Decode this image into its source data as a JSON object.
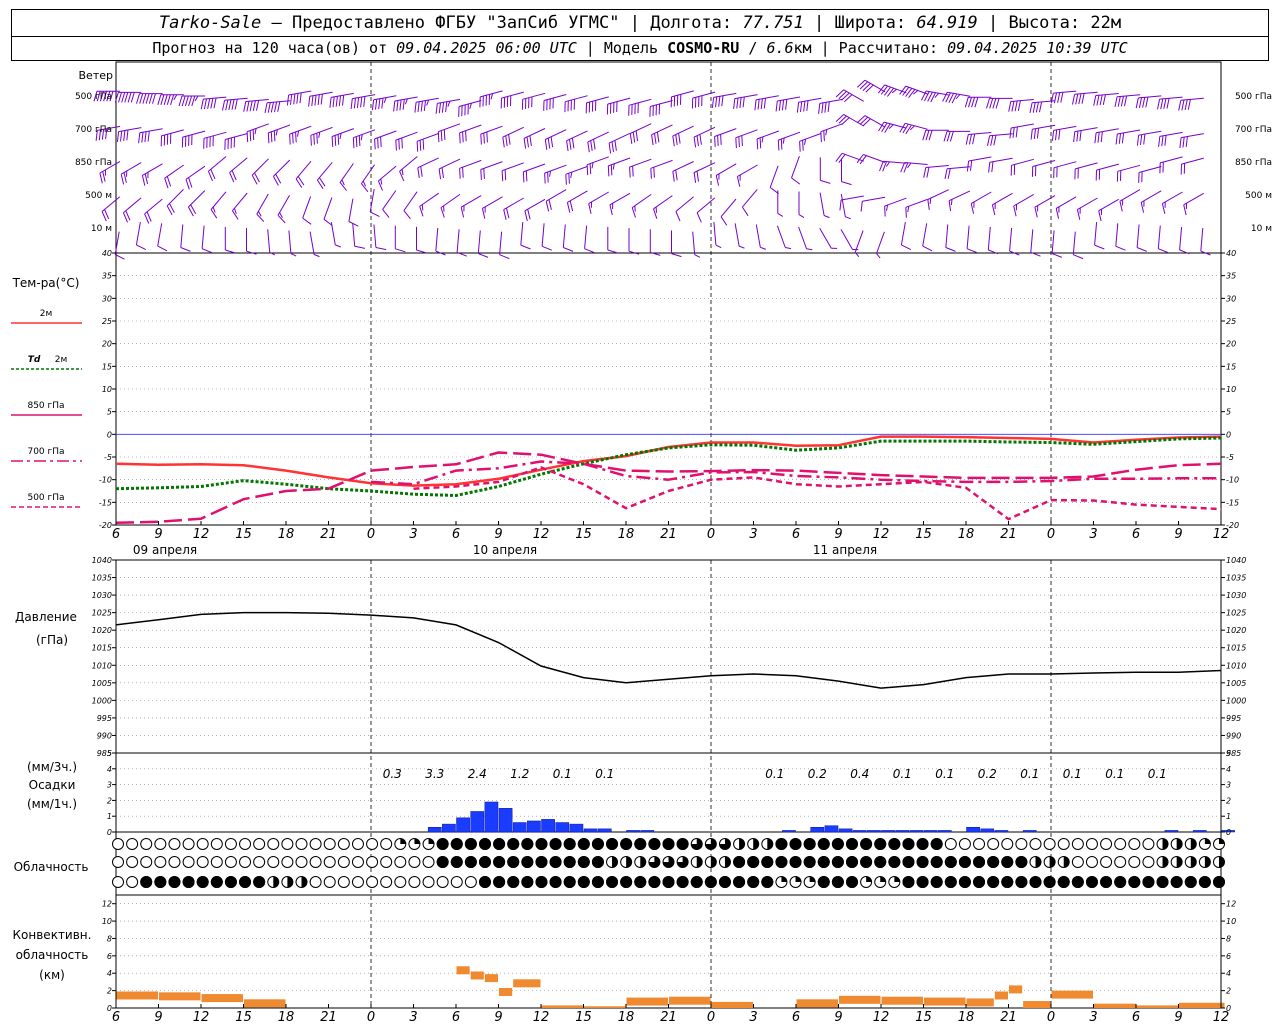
{
  "header": {
    "station": "Tarko-Sale",
    "provider": " – Предоставлено ФГБУ \"ЗапСиб УГМС\" | ",
    "lon_label": "Долгота: ",
    "lon": "77.751",
    "lat_label": " | Широта: ",
    "lat": "64.919",
    "alt_label": " | Высота: ",
    "alt": "22м",
    "forecast_label": "Прогноз на 120 часа(ов) от ",
    "forecast_from": "09.04.2025 06:00 UTC",
    "model_label": "  | Модель ",
    "model": "COSMO-RU",
    "model_sep": " / ",
    "resolution": "6.6",
    "resolution_unit": "км",
    "calc_label": " | Рассчитано: ",
    "calc_time": "09.04.2025 10:39 UTC"
  },
  "labels": {
    "wind": "Ветер",
    "wind_levels": [
      "500 гПа",
      "700 гПа",
      "850 гПа",
      "500 м",
      "10 м"
    ],
    "temp_title": "Тем-ра(°С)",
    "t2m": "2м",
    "td_prefix": "Td",
    "td2m": "2м",
    "t850": "850 гПа",
    "t700": "700 гПа",
    "t500": "500 гПа",
    "pressure1": "Давление",
    "pressure2": "(гПа)",
    "precip1": "(мм/3ч.)",
    "precip2": "Осадки",
    "precip3": "(мм/1ч.)",
    "cloud": "Облачность",
    "conv1": "Конвективн.",
    "conv2": "облачность",
    "conv3": "(км)"
  },
  "colors": {
    "t2m": "#ff3333",
    "td": "#007700",
    "upper": "#e0106e",
    "wind": "#7700cc",
    "precip": "#1a3cff",
    "conv": "#f08a30",
    "zero_line": "#3333ff"
  },
  "chart_data": [
    {
      "type": "wind-barbs",
      "levels": [
        "500 гПа",
        "700 гПа",
        "850 гПа",
        "500 м",
        "10 м"
      ],
      "x_hours": [
        0,
        3,
        6,
        9,
        12,
        15,
        18,
        21,
        24,
        27,
        30,
        33,
        36,
        39,
        42,
        45,
        48,
        51,
        54,
        57,
        60,
        63,
        66,
        69,
        72,
        75,
        78
      ],
      "speed_ms": [
        [
          30,
          30,
          28,
          27,
          26,
          25,
          25,
          24,
          23,
          23,
          22,
          22,
          21,
          21,
          21,
          20,
          20,
          20,
          22,
          23,
          23,
          22,
          22,
          21,
          21,
          21,
          21
        ],
        [
          22,
          22,
          21,
          20,
          19,
          18,
          18,
          17,
          17,
          17,
          16,
          16,
          16,
          15,
          15,
          15,
          14,
          14,
          17,
          18,
          17,
          16,
          16,
          16,
          16,
          16,
          16
        ],
        [
          13,
          13,
          12,
          11,
          10,
          10,
          9,
          9,
          10,
          11,
          12,
          13,
          13,
          12,
          11,
          9,
          6,
          5,
          12,
          13,
          12,
          11,
          11,
          11,
          11,
          11,
          11
        ],
        [
          11,
          11,
          10,
          9,
          8,
          7,
          6,
          7,
          8,
          9,
          10,
          10,
          9,
          8,
          7,
          5,
          4,
          4,
          7,
          8,
          8,
          9,
          9,
          9,
          9,
          9,
          9
        ],
        [
          6,
          6,
          5,
          5,
          4,
          4,
          5,
          6,
          6,
          6,
          6,
          6,
          5,
          5,
          4,
          3,
          3,
          3,
          4,
          5,
          5,
          6,
          6,
          6,
          6,
          6,
          6
        ]
      ],
      "dir_deg": [
        [
          270,
          270,
          270,
          265,
          265,
          260,
          260,
          260,
          260,
          255,
          255,
          255,
          255,
          255,
          255,
          260,
          260,
          260,
          300,
          290,
          280,
          270,
          265,
          265,
          265,
          265,
          265
        ],
        [
          260,
          260,
          255,
          255,
          250,
          250,
          250,
          250,
          250,
          250,
          245,
          245,
          245,
          245,
          245,
          250,
          250,
          250,
          300,
          285,
          270,
          265,
          260,
          260,
          260,
          260,
          260
        ],
        [
          240,
          240,
          235,
          230,
          225,
          220,
          215,
          230,
          245,
          250,
          250,
          250,
          250,
          250,
          245,
          240,
          200,
          180,
          290,
          275,
          265,
          260,
          255,
          255,
          255,
          255,
          255
        ],
        [
          230,
          230,
          225,
          220,
          210,
          200,
          190,
          215,
          235,
          240,
          240,
          240,
          240,
          235,
          230,
          220,
          180,
          170,
          260,
          250,
          245,
          240,
          240,
          240,
          240,
          240,
          240
        ],
        [
          190,
          190,
          185,
          180,
          175,
          170,
          175,
          180,
          185,
          185,
          185,
          185,
          180,
          180,
          175,
          170,
          160,
          150,
          200,
          190,
          185,
          185,
          185,
          185,
          185,
          185,
          185
        ]
      ]
    },
    {
      "type": "line",
      "title": "Тем-ра(°С)",
      "ylim": [
        -20,
        40
      ],
      "yticks": [
        -20,
        -15,
        -10,
        -5,
        0,
        5,
        10,
        15,
        20,
        25,
        30,
        35,
        40
      ],
      "x_hours": [
        0,
        3,
        6,
        9,
        12,
        15,
        18,
        21,
        24,
        27,
        30,
        33,
        36,
        39,
        42,
        45,
        48,
        51,
        54,
        57,
        60,
        63,
        66,
        69,
        72,
        75,
        78
      ],
      "series": [
        {
          "name": "2м",
          "values": [
            -6.5,
            -6.7,
            -6.6,
            -6.8,
            -8.0,
            -9.5,
            -10.8,
            -11.3,
            -11.0,
            -9.8,
            -7.8,
            -5.9,
            -4.8,
            -2.8,
            -1.8,
            -1.8,
            -2.5,
            -2.4,
            -0.5,
            -0.5,
            -0.6,
            -0.8,
            -1.0,
            -1.8,
            -1.2,
            -0.7,
            -0.5
          ]
        },
        {
          "name": "Td 2м",
          "values": [
            -12.0,
            -11.8,
            -11.5,
            -10.2,
            -11.0,
            -12.0,
            -12.5,
            -13.2,
            -13.5,
            -11.5,
            -8.8,
            -6.5,
            -4.5,
            -3.0,
            -2.3,
            -2.4,
            -3.5,
            -3.0,
            -1.5,
            -1.5,
            -1.5,
            -1.7,
            -1.8,
            -2.2,
            -1.6,
            -1.0,
            -0.8
          ]
        },
        {
          "name": "850 гПа",
          "values": [
            -19.5,
            -19.3,
            -18.6,
            -14.3,
            -12.5,
            -12.0,
            -8.0,
            -7.2,
            -6.6,
            -4.0,
            -4.5,
            -6.5,
            -8.0,
            -8.2,
            -8.1,
            -7.9,
            -8.0,
            -8.5,
            -9.0,
            -9.3,
            -9.6,
            -9.6,
            -9.6,
            -9.3,
            -7.8,
            -6.8,
            -6.5
          ]
        },
        {
          "name": "700 гПа",
          "values": [
            null,
            null,
            null,
            null,
            null,
            null,
            -10.5,
            -11.0,
            -8.0,
            -7.5,
            -6.0,
            -6.5,
            -9.2,
            -10.0,
            -8.4,
            -8.3,
            -9.2,
            -9.5,
            -10.0,
            -10.3,
            -10.5,
            -10.5,
            -10.3,
            -9.8,
            -9.8,
            -9.7,
            -9.7
          ]
        },
        {
          "name": "500 гПа",
          "values": [
            null,
            null,
            null,
            null,
            null,
            null,
            null,
            -12.0,
            -11.5,
            -10.5,
            -7.3,
            -11.0,
            -16.3,
            -12.5,
            -10.0,
            -9.5,
            -11.0,
            -11.5,
            -11.0,
            -10.5,
            -11.8,
            -18.7,
            -14.5,
            -14.6,
            -15.5,
            -16.0,
            -16.5
          ]
        }
      ]
    },
    {
      "type": "line",
      "title": "Давление",
      "ylim": [
        985,
        1040
      ],
      "yticks": [
        985,
        990,
        995,
        1000,
        1005,
        1010,
        1015,
        1020,
        1025,
        1030,
        1035,
        1040
      ],
      "x_hours": [
        0,
        3,
        6,
        9,
        12,
        15,
        18,
        21,
        24,
        27,
        30,
        33,
        36,
        39,
        42,
        45,
        48,
        51,
        54,
        57,
        60,
        63,
        66,
        69,
        72,
        75,
        78
      ],
      "series": [
        {
          "name": "Давление",
          "values": [
            1021.5,
            1023.0,
            1024.5,
            1025.0,
            1025.0,
            1024.8,
            1024.3,
            1023.5,
            1021.5,
            1016.5,
            1009.8,
            1006.5,
            1005.0,
            1006.0,
            1007.0,
            1007.5,
            1007.0,
            1005.5,
            1003.5,
            1004.5,
            1006.5,
            1007.5,
            1007.5,
            1007.8,
            1008.0,
            1008.0,
            1008.5
          ]
        }
      ]
    },
    {
      "type": "bar",
      "title": "Осадки",
      "ylim": [
        0,
        5
      ],
      "yticks": [
        0,
        1,
        2,
        3,
        4,
        5
      ],
      "x_hours": [
        21,
        22,
        23,
        24,
        25,
        26,
        27,
        28,
        29,
        30,
        31,
        32,
        33,
        34,
        35,
        36,
        37,
        38,
        39,
        40,
        41,
        42,
        43,
        44,
        45,
        46,
        47,
        48,
        49,
        50,
        51,
        52,
        53,
        54,
        55,
        56,
        57,
        58,
        59,
        60,
        61,
        62,
        63,
        64,
        65,
        66,
        67,
        68,
        69,
        70,
        71,
        72,
        73,
        74,
        75,
        76,
        77,
        78
      ],
      "values": [
        0,
        0.3,
        0.5,
        0.9,
        1.3,
        1.9,
        1.5,
        0.6,
        0.7,
        0.8,
        0.6,
        0.5,
        0.2,
        0.2,
        0,
        0.1,
        0.1,
        0,
        0,
        0,
        0,
        0,
        0,
        0,
        0,
        0,
        0.1,
        0,
        0.3,
        0.4,
        0.2,
        0.1,
        0.1,
        0.1,
        0.1,
        0.1,
        0.1,
        0.1,
        0,
        0.3,
        0.2,
        0.1,
        0,
        0.1,
        0,
        0,
        0,
        0,
        0,
        0,
        0,
        0,
        0,
        0.1,
        0,
        0.1,
        0,
        0.1
      ],
      "totals_3h": [
        {
          "x_hour": 19.5,
          "value": "0.3"
        },
        {
          "x_hour": 22.5,
          "value": "3.3"
        },
        {
          "x_hour": 25.5,
          "value": "2.4"
        },
        {
          "x_hour": 28.5,
          "value": "1.2"
        },
        {
          "x_hour": 31.5,
          "value": "0.1"
        },
        {
          "x_hour": 34.5,
          "value": "0.1"
        },
        {
          "x_hour": 46.5,
          "value": "0.1"
        },
        {
          "x_hour": 49.5,
          "value": "0.2"
        },
        {
          "x_hour": 52.5,
          "value": "0.4"
        },
        {
          "x_hour": 55.5,
          "value": "0.1"
        },
        {
          "x_hour": 58.5,
          "value": "0.1"
        },
        {
          "x_hour": 61.5,
          "value": "0.2"
        },
        {
          "x_hour": 64.5,
          "value": "0.1"
        },
        {
          "x_hour": 67.5,
          "value": "0.1"
        },
        {
          "x_hour": 70.5,
          "value": "0.1"
        },
        {
          "x_hour": 73.5,
          "value": "0.1"
        }
      ]
    },
    {
      "type": "cloud-cover-symbols",
      "title": "Облачность",
      "x_hours": [
        0,
        3,
        6,
        9,
        12,
        15,
        18,
        21,
        24,
        27,
        30,
        33,
        36,
        39,
        42,
        45,
        48,
        51,
        54,
        57,
        60,
        63,
        66,
        69,
        72,
        75,
        78
      ],
      "rows_fraction": [
        [
          0,
          0,
          0,
          0,
          0,
          0,
          0,
          0.25,
          1,
          1,
          1,
          1,
          1,
          1,
          0.75,
          0.5,
          1,
          1,
          1,
          1,
          0,
          0,
          0,
          0,
          0,
          0.5,
          0.25
        ],
        [
          0,
          0,
          0,
          0,
          0,
          0,
          0,
          0,
          1,
          1,
          1,
          1,
          0.5,
          0.75,
          0.5,
          1,
          1,
          1,
          1,
          1,
          1,
          1,
          0.5,
          0,
          0,
          0.5,
          0.5
        ],
        [
          0,
          1,
          1,
          1,
          0.5,
          0,
          0,
          0,
          0,
          1,
          1,
          1,
          1,
          1,
          1,
          1,
          0.25,
          1,
          0.25,
          1,
          1,
          1,
          1,
          1,
          1,
          1,
          1
        ]
      ]
    },
    {
      "type": "bar",
      "title": "Конвективн. облачность",
      "ylim": [
        0,
        13
      ],
      "yticks": [
        0,
        2,
        4,
        6,
        8,
        10,
        12
      ],
      "x_hours": [
        0,
        3,
        6,
        9,
        12,
        15,
        18,
        21,
        24,
        25,
        26,
        27,
        28,
        30,
        33,
        36,
        39,
        42,
        45,
        48,
        51,
        54,
        57,
        60,
        62,
        63,
        64,
        66,
        69,
        72,
        75,
        78
      ],
      "values": [
        1.9,
        1.8,
        1.6,
        1.0,
        0,
        0,
        0,
        0,
        4.8,
        4.2,
        3.9,
        2.3,
        3.3,
        0.3,
        0.2,
        1.2,
        1.3,
        0.7,
        0,
        1.0,
        1.4,
        1.3,
        1.2,
        1.1,
        1.9,
        2.6,
        0.8,
        2.0,
        0.5,
        0.3,
        0.6,
        0.6
      ]
    }
  ],
  "time_axis": {
    "hours": [
      "6",
      "9",
      "12",
      "15",
      "18",
      "21",
      "0",
      "3",
      "6",
      "9",
      "12",
      "15",
      "18",
      "21",
      "0",
      "3",
      "6",
      "9",
      "12",
      "15",
      "18",
      "21",
      "0",
      "3",
      "6",
      "9",
      "12"
    ],
    "dates": [
      {
        "x_hour": 6,
        "label": "09 апреля"
      },
      {
        "x_hour": 30,
        "label": "10 апреля"
      },
      {
        "x_hour": 54,
        "label": "11 апреля"
      }
    ],
    "midnights": [
      18,
      42,
      66
    ]
  }
}
